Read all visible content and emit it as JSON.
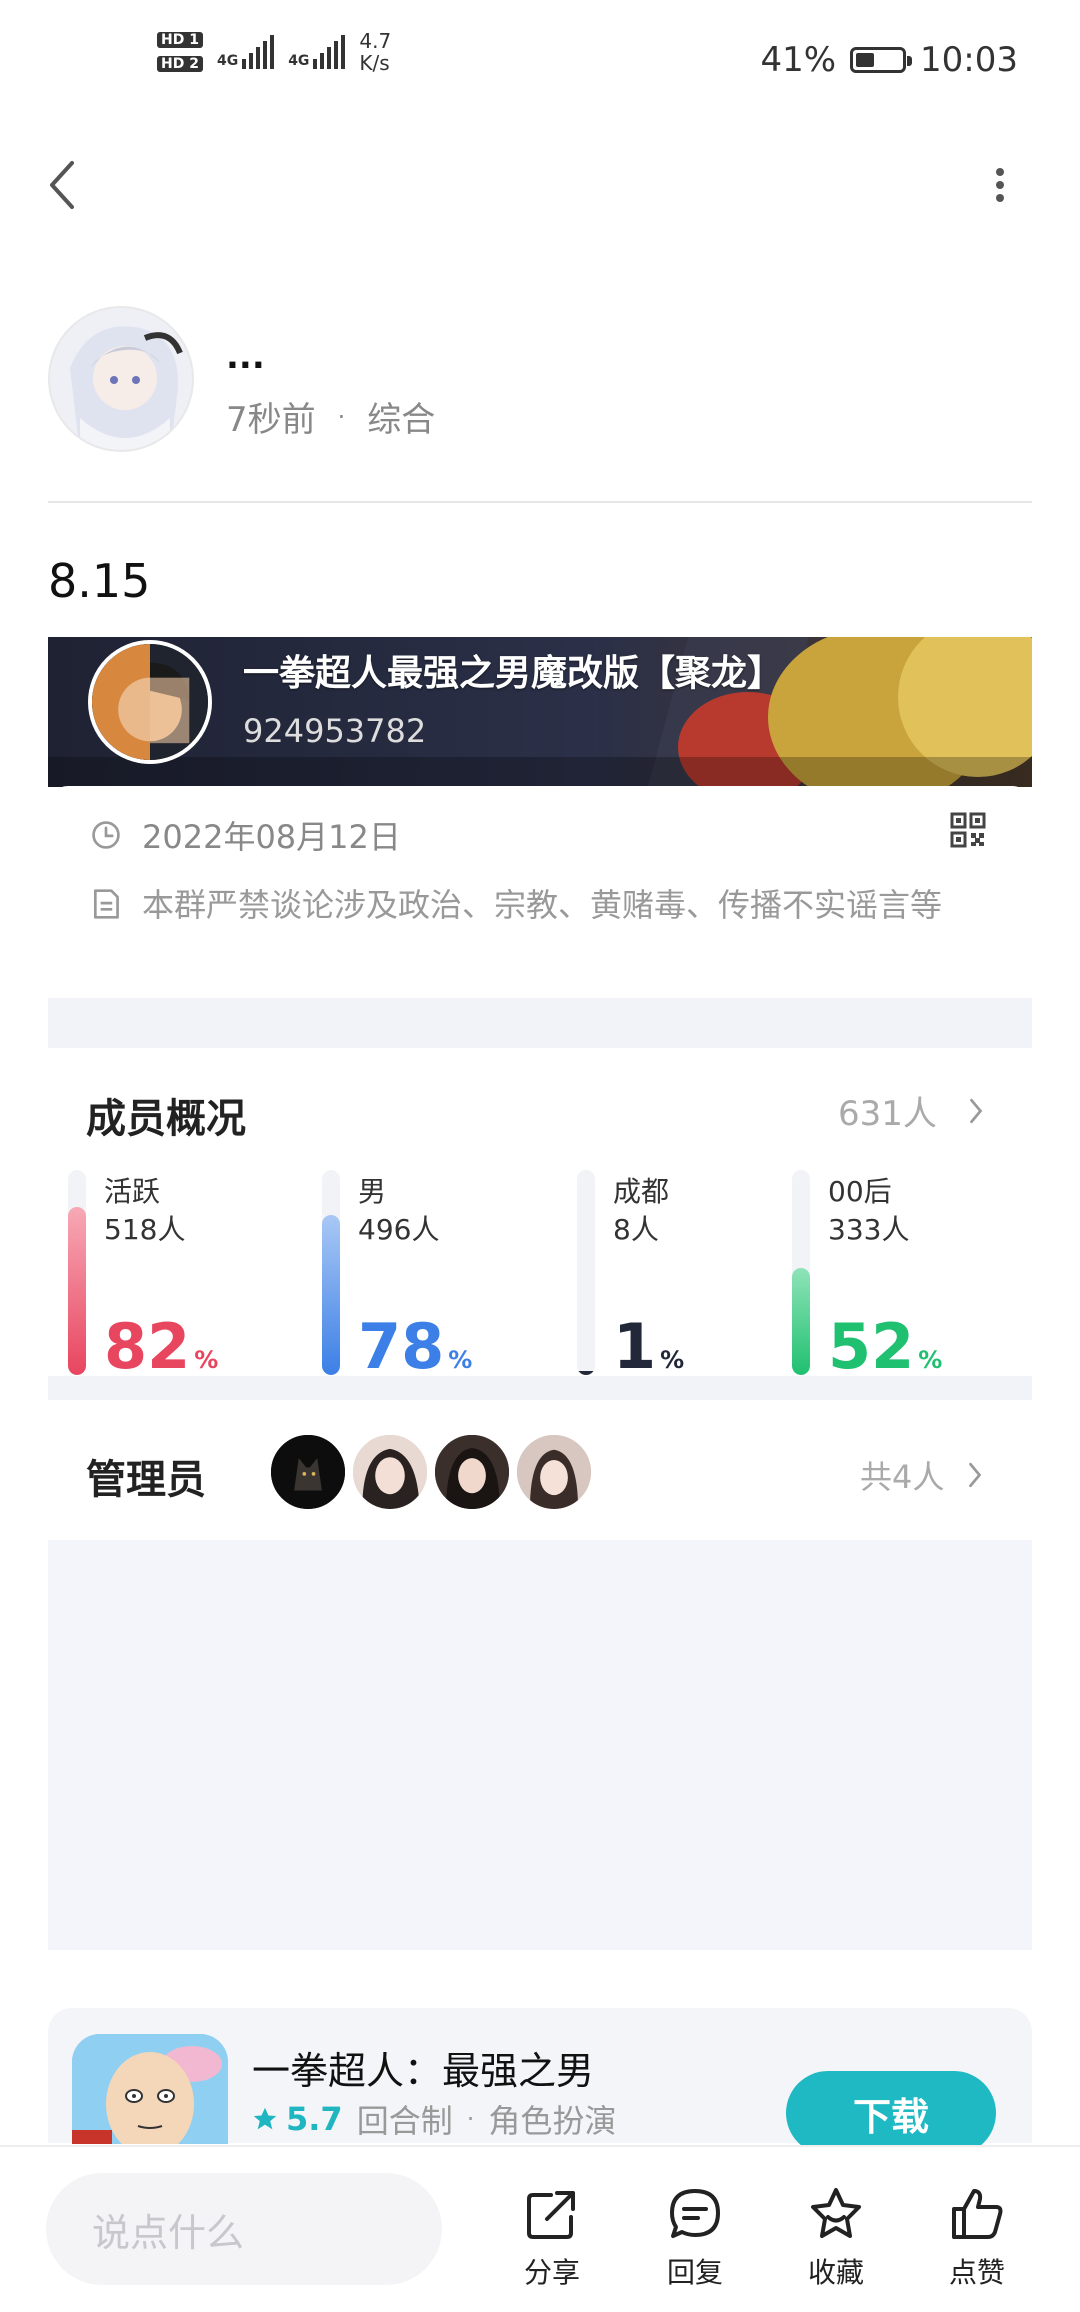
{
  "status_bar": {
    "sim1": "HD 1",
    "sim2": "HD 2",
    "net1": "4G",
    "net2": "4G",
    "speed_value": "4.7",
    "speed_unit": "K/s",
    "battery_percent": "41%",
    "battery_level": 0.41,
    "time": "10:03"
  },
  "header": {
    "back_icon": "back-arrow-icon",
    "more_icon": "more-vertical-icon"
  },
  "author": {
    "name": "...",
    "time": "7秒前",
    "category": "综合"
  },
  "post": {
    "title": "8.15"
  },
  "group": {
    "name": "一拳超人最强之男魔改版【聚龙】",
    "id": "924953782",
    "date": "2022年08月12日",
    "rules": "本群严禁谈论涉及政治、宗教、黄赌毒、传播不实谣言等"
  },
  "members": {
    "title": "成员概况",
    "total": "631人",
    "stats": [
      {
        "label": "活跃",
        "count": "518人",
        "percent": "82",
        "value": 82,
        "color": "#e8455f",
        "color_light": "#f7a9b6"
      },
      {
        "label": "男",
        "count": "496人",
        "percent": "78",
        "value": 78,
        "color": "#3c7fe6",
        "color_light": "#a9c8f5"
      },
      {
        "label": "成都",
        "count": "8人",
        "percent": "1",
        "value": 1,
        "color": "#22283a",
        "color_light": "#22283a"
      },
      {
        "label": "00后",
        "count": "333人",
        "percent": "52",
        "value": 52,
        "color": "#1fc070",
        "color_light": "#8fe3b8"
      }
    ],
    "percent_sign": "%"
  },
  "admins": {
    "title": "管理员",
    "count": "共4人"
  },
  "app": {
    "name": "一拳超人：最强之男",
    "rating": "5.7",
    "tag1": "回合制",
    "tag2": "角色扮演",
    "download": "下载"
  },
  "bottom_bar": {
    "placeholder": "说点什么",
    "share": "分享",
    "reply": "回复",
    "favorite": "收藏",
    "like": "点赞"
  }
}
